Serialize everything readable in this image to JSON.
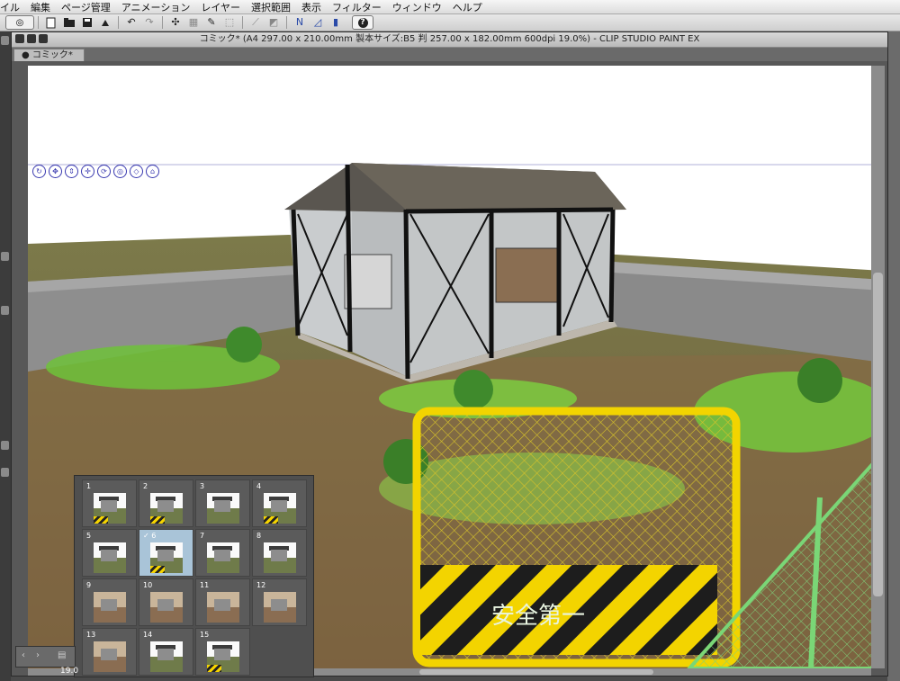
{
  "menu": [
    "イル",
    "編集",
    "ページ管理",
    "アニメーション",
    "レイヤー",
    "選択範囲",
    "表示",
    "フィルター",
    "ウィンドウ",
    "ヘルプ"
  ],
  "toolbar": {
    "logo": "◎",
    "help": "?",
    "icons": [
      "new-file-icon",
      "open-file-icon",
      "save-icon",
      "export-icon",
      "undo-icon",
      "redo-icon",
      "transform-icon",
      "grid-icon",
      "eyedropper-icon",
      "snap-icon",
      "ruler-icon",
      "perspective-icon",
      "symmetry-icon"
    ]
  },
  "window": {
    "title": "コミック* (A4 297.00 x 210.00mm 製本サイズ:B5 判 257.00 x 182.00mm 600dpi 19.0%)  - CLIP STUDIO PAINT EX",
    "tab": "● コミック*"
  },
  "scene": {
    "sign_text": "安全第一"
  },
  "pages": {
    "items": [
      {
        "num": "1",
        "type": "outdoor"
      },
      {
        "num": "2",
        "type": "outdoor"
      },
      {
        "num": "3",
        "type": "outdoor"
      },
      {
        "num": "4",
        "type": "outdoor"
      },
      {
        "num": "5",
        "type": "outdoor"
      },
      {
        "num": "✓ 6",
        "type": "outdoor",
        "selected": true
      },
      {
        "num": "7",
        "type": "outdoor"
      },
      {
        "num": "8",
        "type": "outdoor"
      },
      {
        "num": "9",
        "type": "indoor"
      },
      {
        "num": "10",
        "type": "indoor"
      },
      {
        "num": "11",
        "type": "indoor"
      },
      {
        "num": "12",
        "type": "indoor"
      },
      {
        "num": "13",
        "type": "indoor"
      },
      {
        "num": "14",
        "type": "outdoor"
      },
      {
        "num": "15",
        "type": "outdoor"
      }
    ]
  },
  "status": {
    "zoom": "19.0"
  }
}
